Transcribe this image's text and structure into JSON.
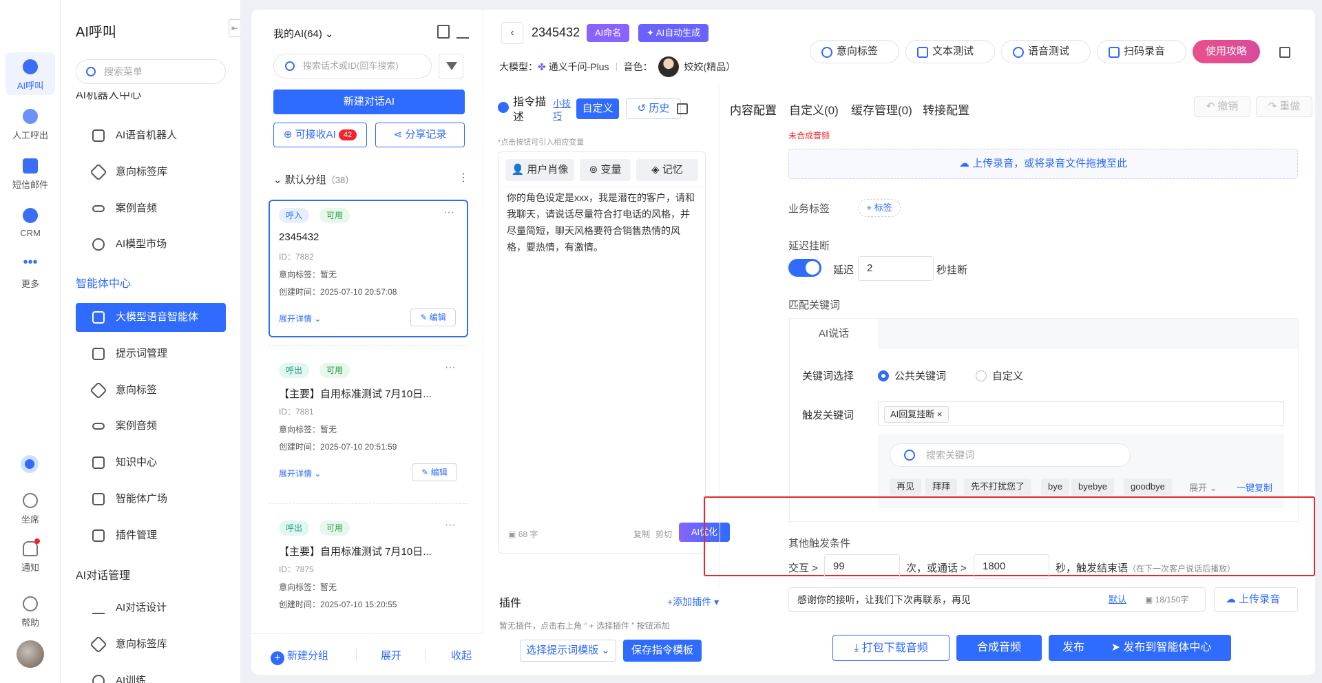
{
  "rail": {
    "items": [
      {
        "label": "AI呼叫",
        "icon": "robot-icon"
      },
      {
        "label": "人工呼出",
        "icon": "phone-icon"
      },
      {
        "label": "短信邮件",
        "icon": "mail-icon"
      },
      {
        "label": "CRM",
        "icon": "crm-icon"
      },
      {
        "label": "更多",
        "icon": "more-icon"
      }
    ],
    "bottom": [
      {
        "label": "坐席",
        "icon": "headset-icon"
      },
      {
        "label": "通知",
        "icon": "bell-icon"
      },
      {
        "label": "帮助",
        "icon": "help-icon"
      }
    ]
  },
  "menu": {
    "title": "AI呼叫",
    "search_placeholder": "搜索菜单",
    "group_robot": "AI机器人中心",
    "robot_items": [
      "AI语音机器人",
      "意向标签库",
      "案例音频",
      "AI模型市场"
    ],
    "group_agent": "智能体中心",
    "agent_items": [
      "大模型语音智能体",
      "提示词管理",
      "意向标签",
      "案例音频",
      "知识中心",
      "智能体广场",
      "插件管理"
    ],
    "group_dialog": "AI对话管理",
    "dialog_items": [
      "AI对话设计",
      "意向标签库",
      "AI训练"
    ]
  },
  "list": {
    "my_ai": "我的AI(64)",
    "search_placeholder": "搜索话术或ID(回车搜索)",
    "new_ai": "新建对话AI",
    "receivable_ai": "可接收AI",
    "receivable_count": "42",
    "share_record": "分享记录",
    "group_name": "默认分组",
    "group_count": "（38）",
    "intent_label": "意向标签：",
    "created_label": "创建时间：",
    "expand_details": "展开详情",
    "edit": "编辑",
    "cards": [
      {
        "direction": "呼入",
        "status": "可用",
        "name": "2345432",
        "id": "ID：7882",
        "intent": "暂无",
        "created": "2025-07-10 20:57:08"
      },
      {
        "direction": "呼出",
        "status": "可用",
        "name": "【主要】自用标准测试 7月10日...",
        "id": "ID：7881",
        "intent": "暂无",
        "created": "2025-07-10 20:51:59"
      },
      {
        "direction": "呼出",
        "status": "可用",
        "name": "【主要】自用标准测试 7月10日...",
        "id": "ID：7875",
        "intent": "暂无",
        "created": "2025-07-10 15:20:55"
      }
    ],
    "footer_new_group": "新建分组",
    "footer_expand": "展开",
    "footer_collapse": "收起"
  },
  "header": {
    "title": "2345432",
    "ai_name": "AI命名",
    "ai_auto": "AI自动生成",
    "model_label": "大模型：",
    "model_value": "通义千问-Plus",
    "voice_label": "音色：",
    "voice_value": "姣姣(精品）",
    "tools": [
      "意向标签",
      "文本测试",
      "语音测试",
      "扫码录音"
    ],
    "guide": "使用攻略"
  },
  "instruction": {
    "title": "指令描述",
    "tips": "小技巧",
    "custom": "自定义",
    "history": "历史",
    "hint": "*点击按钮可引入相应变量",
    "tabs": [
      "用户肖像",
      "变量",
      "记忆"
    ],
    "text": "你的角色设定是xxx，我是潜在的客户，请和我聊天，请说话尽量符合打电话的风格，并尽量简短，聊天风格要符合销售热情的风格，要热情，有激情。",
    "char_count": "68 字",
    "copy": "复制",
    "cut": "剪切",
    "ai_optimize": "AI优化",
    "plugins_title": "插件",
    "add_plugin": "+添加插件",
    "plugin_hint": "暂无插件，点击右上角 “ + 选择插件 ” 按钮添加",
    "select_template": "选择提示词模版",
    "save_template": "保存指令模板"
  },
  "config": {
    "tabs": [
      "内容配置",
      "自定义(0)",
      "缓存管理(0)",
      "转接配置"
    ],
    "undo": "撤销",
    "redo": "重做",
    "unsynth": "未合成音频",
    "upload_drop": "上传录音，或将录音文件拖拽至此",
    "biz_tag_label": "业务标签",
    "add_tag": "+ 标签",
    "delay_hangup_label": "延迟挂断",
    "delay_prefix": "延迟",
    "delay_value": "2",
    "delay_suffix": "秒挂断",
    "match_kw_label": "匹配关键词",
    "ai_say_tab": "AI说话",
    "kw_select_label": "关键词选择",
    "kw_public": "公共关键词",
    "kw_custom": "自定义",
    "trigger_label": "触发关键词",
    "trigger_chip": "AI回复挂断",
    "kw_search_placeholder": "搜索关键词",
    "kw_chips": [
      "再见",
      "拜拜",
      "先不打扰您了",
      "bye",
      "byebye",
      "goodbye"
    ],
    "kw_expand": "展开",
    "kw_copy_all": "一键复制",
    "other_trigger_label": "其他触发条件",
    "interact_prefix": "交互 >",
    "interact_value": "99",
    "call_mid": "次，或通话 >",
    "call_value": "1800",
    "call_suffix": "秒，触发结束语",
    "call_note": "（在下一次客户说话后播放）",
    "end_text": "感谢你的接听，让我们下次再联系，再见",
    "default": "默认",
    "end_count": "18/150字",
    "upload_record": "上传录音"
  },
  "footer": {
    "download": "打包下载音频",
    "synth": "合成音频",
    "publish": "发布",
    "publish_center": "发布到智能体中心"
  },
  "colors": {
    "primary": "#2f6bff",
    "guide": "#e9518a",
    "danger": "#e8262b"
  }
}
